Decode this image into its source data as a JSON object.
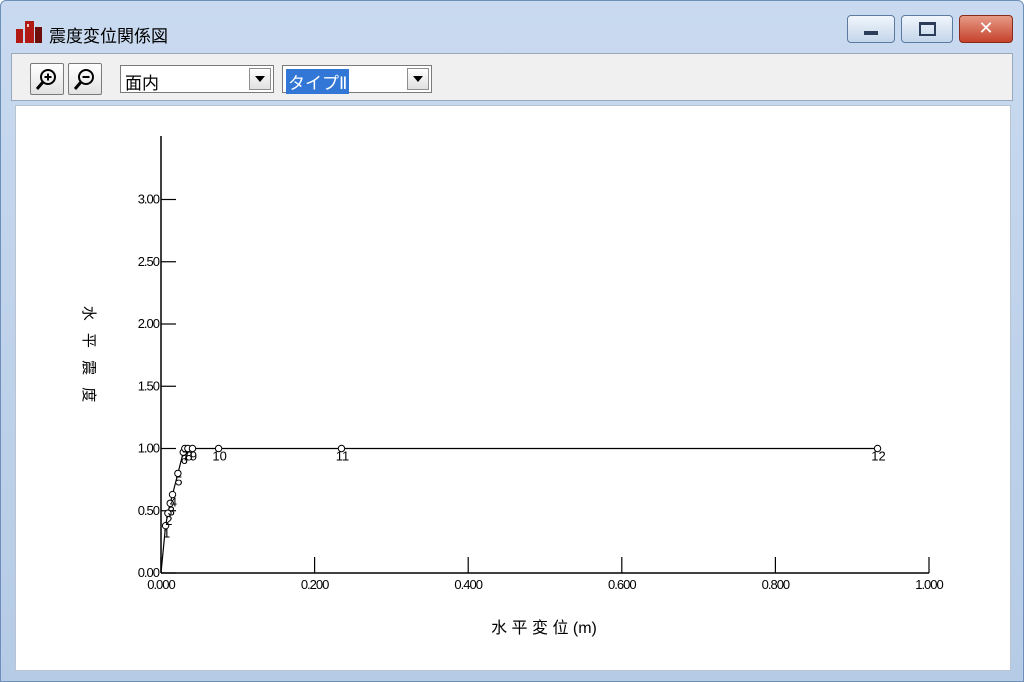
{
  "window": {
    "title": "震度変位関係図"
  },
  "toolbar": {
    "zoom_in": "zoom-in-icon",
    "zoom_out": "zoom-out-icon",
    "plane_select": {
      "value": "面内"
    },
    "type_select": {
      "value": "タイプⅡ"
    }
  },
  "chart_data": {
    "type": "line",
    "xlabel": "水 平 変 位 (m)",
    "ylabel": "水 平 震 度",
    "xlim": [
      0,
      1.0
    ],
    "ylim": [
      0,
      3.3
    ],
    "x_ticks": [
      "0.000",
      "0.200",
      "0.400",
      "0.600",
      "0.800",
      "1.000"
    ],
    "y_ticks": [
      "0.00",
      "0.50",
      "1.00",
      "1.50",
      "2.00",
      "2.50",
      "3.00"
    ],
    "grid": false,
    "series": [
      {
        "points": [
          {
            "label": "",
            "x": 0.0,
            "y": 0.0
          },
          {
            "label": "1",
            "x": 0.006,
            "y": 0.38
          },
          {
            "label": "2",
            "x": 0.009,
            "y": 0.48
          },
          {
            "label": "3",
            "x": 0.012,
            "y": 0.56
          },
          {
            "label": "4",
            "x": 0.015,
            "y": 0.63
          },
          {
            "label": "5",
            "x": 0.022,
            "y": 0.8
          },
          {
            "label": "6",
            "x": 0.029,
            "y": 0.97
          },
          {
            "label": "7",
            "x": 0.031,
            "y": 1.0
          },
          {
            "label": "8",
            "x": 0.035,
            "y": 1.0
          },
          {
            "label": "9",
            "x": 0.041,
            "y": 1.0
          },
          {
            "label": "10",
            "x": 0.075,
            "y": 1.0
          },
          {
            "label": "11",
            "x": 0.235,
            "y": 1.0
          },
          {
            "label": "12",
            "x": 0.933,
            "y": 1.0
          }
        ]
      }
    ]
  },
  "colors": {
    "title_bg": "#c9daf0",
    "selection": "#3277d6",
    "close_button": "#c6422c"
  }
}
